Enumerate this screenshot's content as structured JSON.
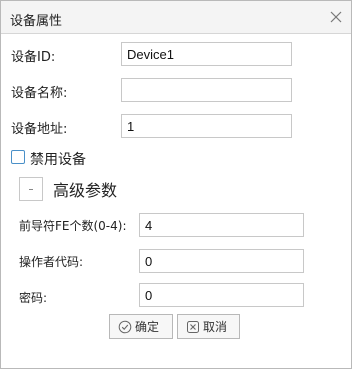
{
  "dialog": {
    "title": "设备属性",
    "close_icon": "close-icon"
  },
  "basic": {
    "device_id_label": "设备ID:",
    "device_id_value": "Device1",
    "device_name_label": "设备名称:",
    "device_name_value": "",
    "device_address_label": "设备地址:",
    "device_address_value": "1",
    "disable_label": "禁用设备",
    "disable_checked": false
  },
  "advanced": {
    "title": "高级参数",
    "toggle_icon": "collapse-icon",
    "fe_count_label": "前导符FE个数(0-4):",
    "fe_count_value": "4",
    "operator_code_label": "操作者代码:",
    "operator_code_value": "0",
    "password_label": "密码:",
    "password_value": "0"
  },
  "buttons": {
    "ok_label": "确定",
    "ok_icon": "check-circle-icon",
    "cancel_label": "取消",
    "cancel_icon": "x-square-icon"
  }
}
